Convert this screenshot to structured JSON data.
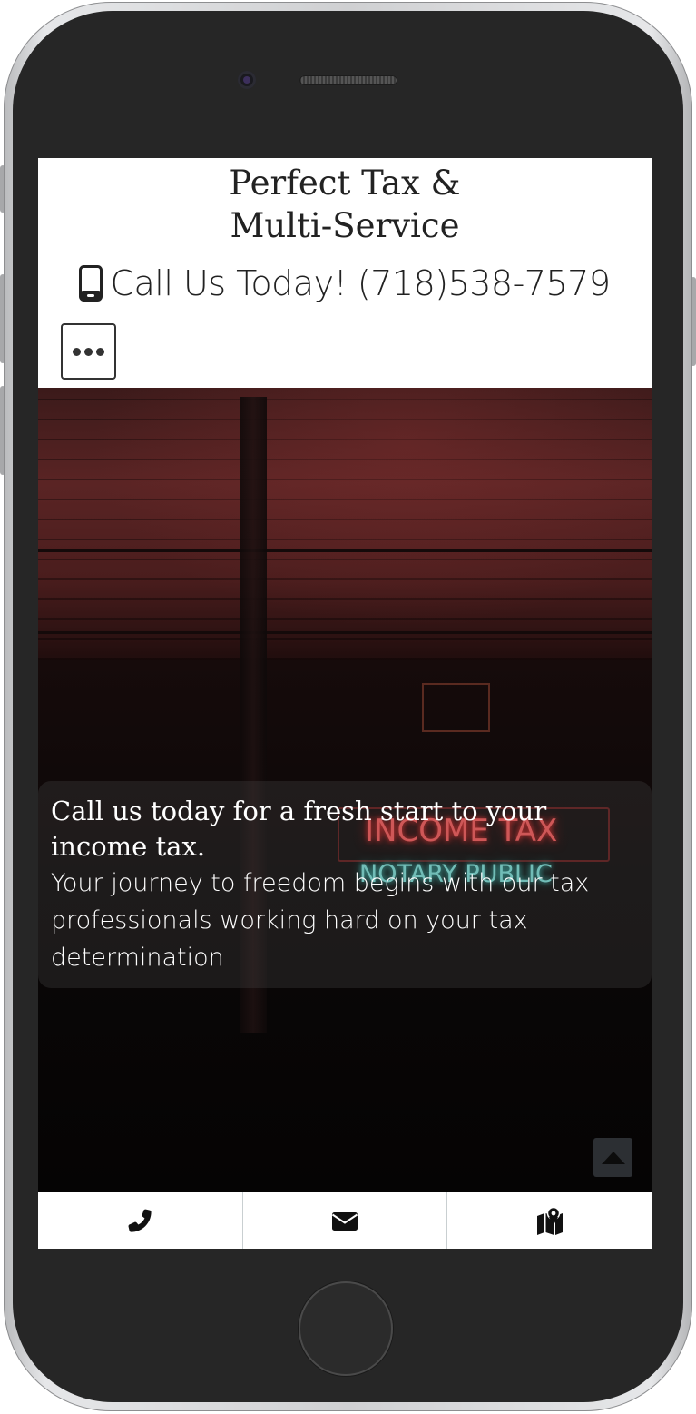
{
  "header": {
    "title_line_1": "Perfect Tax &",
    "title_line_2": "Multi-Service",
    "call_text": "Call Us Today! (718)538-7579"
  },
  "hero": {
    "neon_sign_top": "INCOME TAX",
    "neon_sign_bottom": "NOTARY PUBLIC",
    "caption_title": "Call us today for a fresh start to your income tax.",
    "caption_body": "Your journey to freedom begins with our tax professionals working hard on your tax determination"
  },
  "icons": {
    "call_icon": "mobile-phone-icon",
    "menu_icon": "ellipsis-icon",
    "scroll_top_icon": "caret-up-icon",
    "phone_action_icon": "phone-icon",
    "email_action_icon": "envelope-icon",
    "map_action_icon": "map-marker-icon"
  },
  "colors": {
    "text_dark": "#222222",
    "hero_bg": "#0a0808",
    "neon_red": "#ff5a5a",
    "neon_teal": "#7fe8e0"
  }
}
